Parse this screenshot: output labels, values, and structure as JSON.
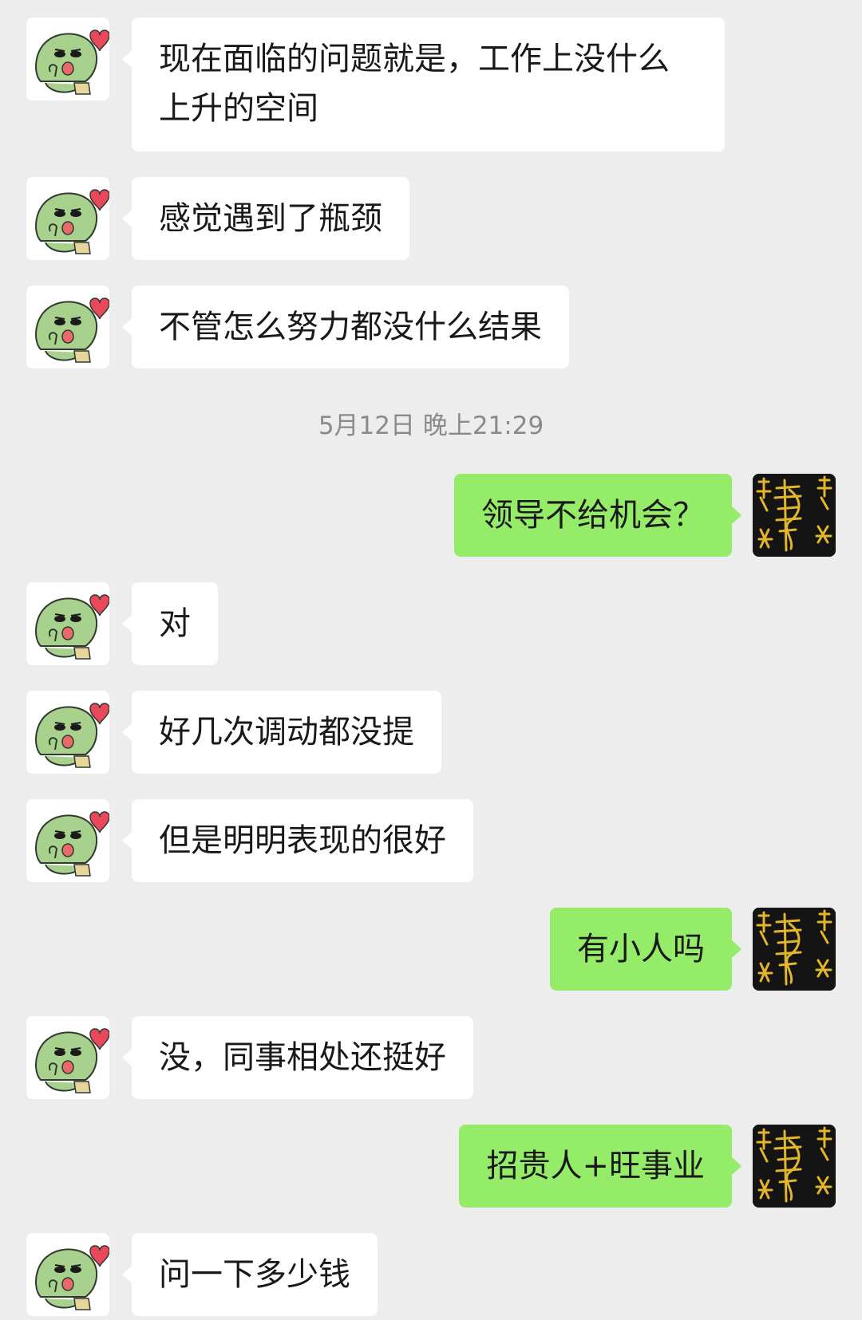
{
  "messages": [
    {
      "side": "left",
      "text": "现在面临的问题就是，工作上没什么上升的空间"
    },
    {
      "side": "left",
      "text": "感觉遇到了瓶颈"
    },
    {
      "side": "left",
      "text": "不管怎么努力都没什么结果"
    },
    {
      "side": "right",
      "text": "领导不给机会？"
    },
    {
      "side": "left",
      "text": "对"
    },
    {
      "side": "left",
      "text": "好几次调动都没提"
    },
    {
      "side": "left",
      "text": "但是明明表现的很好"
    },
    {
      "side": "right",
      "text": "有小人吗"
    },
    {
      "side": "left",
      "text": "没，同事相处还挺好"
    },
    {
      "side": "right",
      "text": "招贵人+旺事业"
    },
    {
      "side": "left",
      "text": "问一下多少钱"
    }
  ],
  "timestamp": "5月12日 晚上21:29",
  "colors": {
    "background": "#ededed",
    "incoming_bubble": "#ffffff",
    "outgoing_bubble": "#95ec69"
  },
  "avatars": {
    "left": "green-dinosaur-sticker-avatar",
    "right": "black-gold-calligraphy-avatar"
  }
}
